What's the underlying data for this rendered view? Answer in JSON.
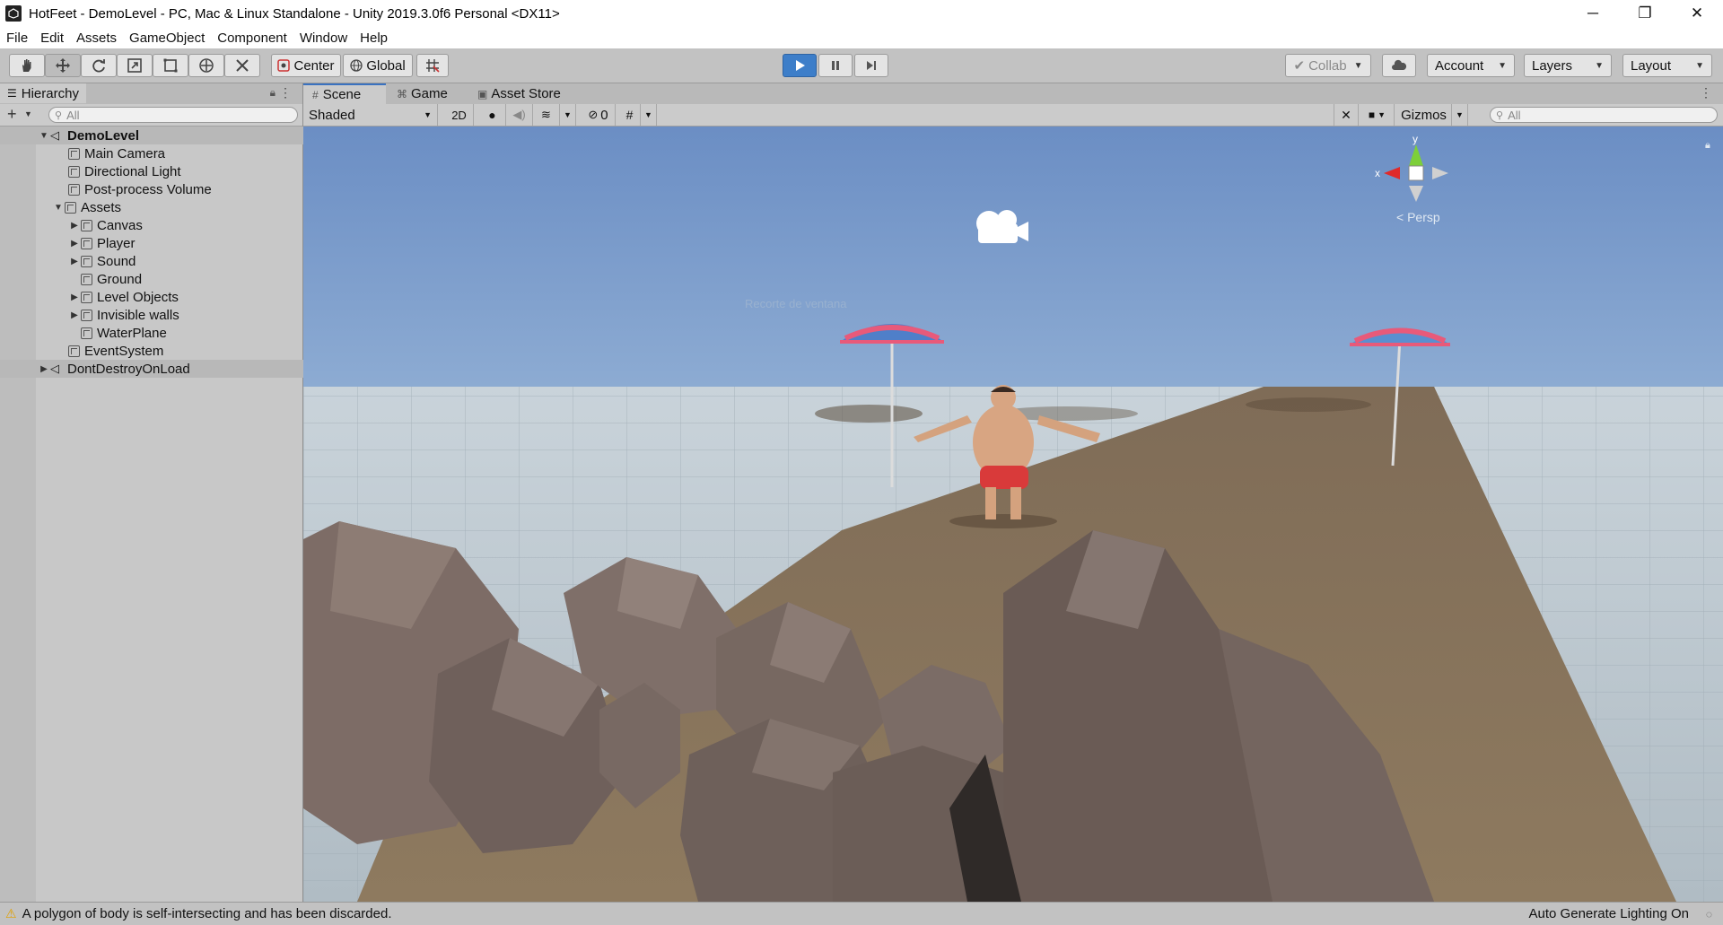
{
  "window": {
    "title": "HotFeet - DemoLevel - PC, Mac & Linux Standalone - Unity 2019.3.0f6 Personal <DX11>",
    "minimize": "─",
    "maximize": "❐",
    "close": "✕"
  },
  "menu": [
    "File",
    "Edit",
    "Assets",
    "GameObject",
    "Component",
    "Window",
    "Help"
  ],
  "toolbar": {
    "pivot_mode": "Center",
    "pivot_rotation": "Global",
    "collab": "Collab",
    "account": "Account",
    "layers": "Layers",
    "layout": "Layout",
    "play_state": "playing"
  },
  "hierarchy": {
    "tab_label": "Hierarchy",
    "search_placeholder": "All",
    "items": [
      {
        "label": "DemoLevel",
        "type": "scene",
        "expanded": true
      },
      {
        "label": "Main Camera",
        "type": "object"
      },
      {
        "label": "Directional Light",
        "type": "object"
      },
      {
        "label": "Post-process Volume",
        "type": "object"
      },
      {
        "label": "Assets",
        "type": "object",
        "expanded": true
      },
      {
        "label": "Canvas",
        "type": "object",
        "collapsed": true
      },
      {
        "label": "Player",
        "type": "object",
        "collapsed": true
      },
      {
        "label": "Sound",
        "type": "object",
        "collapsed": true
      },
      {
        "label": "Ground",
        "type": "object"
      },
      {
        "label": "Level Objects",
        "type": "object",
        "collapsed": true
      },
      {
        "label": "Invisible walls",
        "type": "object",
        "collapsed": true
      },
      {
        "label": "WaterPlane",
        "type": "object"
      },
      {
        "label": "EventSystem",
        "type": "object"
      },
      {
        "label": "DontDestroyOnLoad",
        "type": "scene",
        "collapsed": true
      }
    ]
  },
  "scene_view": {
    "tabs": [
      "Scene",
      "Game",
      "Asset Store"
    ],
    "active_tab": "Scene",
    "draw_mode": "Shaded",
    "mode_2d": "2D",
    "hidden_count": "0",
    "gizmos": "Gizmos",
    "search_placeholder": "All",
    "projection": "Persp",
    "axis_x": "x",
    "axis_y": "y",
    "overlay_text": "Recorte de ventana"
  },
  "status": {
    "message": "A polygon of body is self-intersecting and has been discarded.",
    "right_text": "Auto Generate Lighting On"
  },
  "colors": {
    "play_active": "#3d7ec9",
    "warning": "#e0a000",
    "sand": "#8b7355",
    "rock": "#7d6f68"
  }
}
